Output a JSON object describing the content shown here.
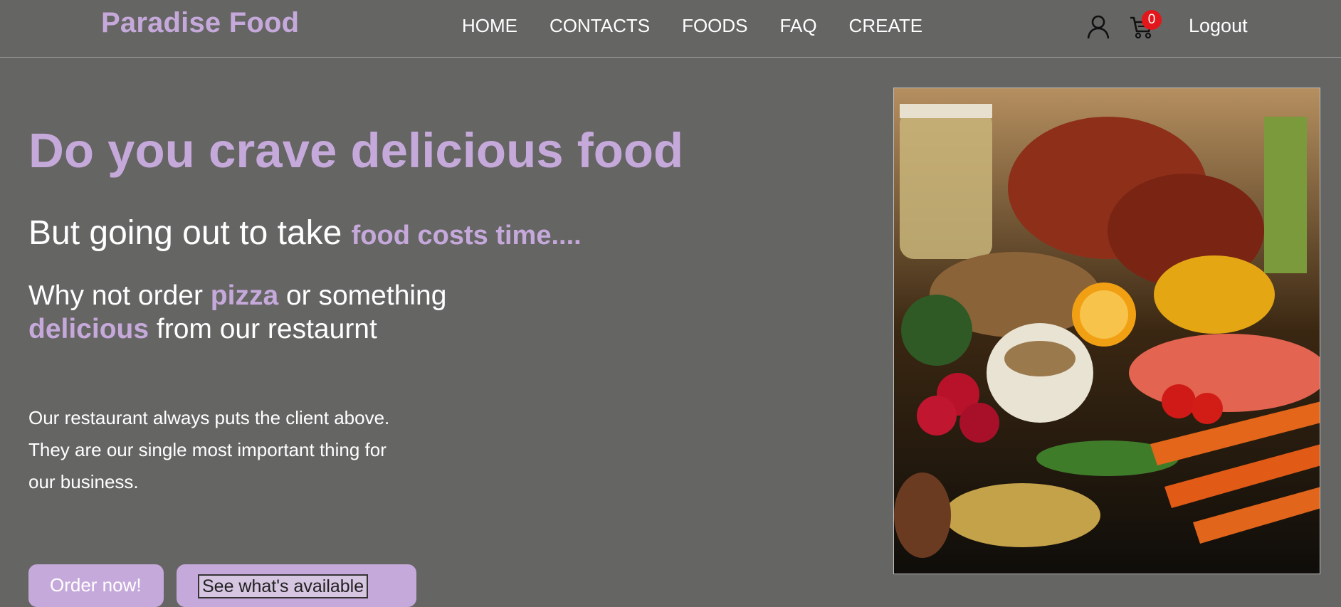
{
  "header": {
    "brand": "Paradise Food",
    "nav_items": [
      {
        "label": "HOME"
      },
      {
        "label": "CONTACTS"
      },
      {
        "label": "FOODS"
      },
      {
        "label": "FAQ"
      },
      {
        "label": "CREATE"
      }
    ],
    "cart_count": "0",
    "logout_label": "Logout",
    "icons": {
      "user": "user-icon",
      "cart": "cart-icon"
    },
    "colors": {
      "brand": "#c6a9db",
      "badge": "#e3161b",
      "background": "#656564"
    }
  },
  "hero": {
    "title": "Do you crave delicious food",
    "line_two_plain": "But going out to take ",
    "line_two_accent": "food costs time....",
    "line_three_part1": "Why not order ",
    "line_three_accent1": "pizza",
    "line_three_part2": " or something ",
    "line_three_accent2": "delicious",
    "line_three_part3": " from our restaurnt",
    "blurb": "Our restaurant always puts the client above. They are our single most important thing for our business."
  },
  "buttons": {
    "order_now": "Order now!",
    "see_available": "See what's available"
  },
  "image": {
    "alt": "Food assortment photo"
  }
}
